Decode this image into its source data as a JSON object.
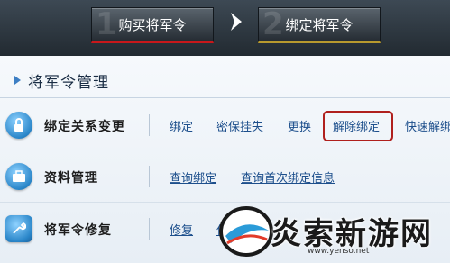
{
  "steps": [
    {
      "label": "购买将军令"
    },
    {
      "label": "绑定将军令"
    }
  ],
  "section": {
    "title": "将军令管理"
  },
  "rows": [
    {
      "name": "绑定关系变更",
      "icon": "lock-icon",
      "links": [
        "绑定",
        "密保挂失",
        "更换",
        "解除绑定",
        "快速解绑"
      ]
    },
    {
      "name": "资料管理",
      "icon": "briefcase-icon",
      "links": [
        "查询绑定",
        "查询首次绑定信息"
      ]
    },
    {
      "name": "将军令修复",
      "icon": "repair-icon",
      "links": [
        "修复",
        "保"
      ]
    }
  ],
  "watermark": {
    "text": "炎索新游网",
    "url": "www.yenso.net"
  },
  "colors": {
    "accent": "#3d7fc4",
    "highlight": "#b0201d",
    "link": "#1d4f8c"
  }
}
